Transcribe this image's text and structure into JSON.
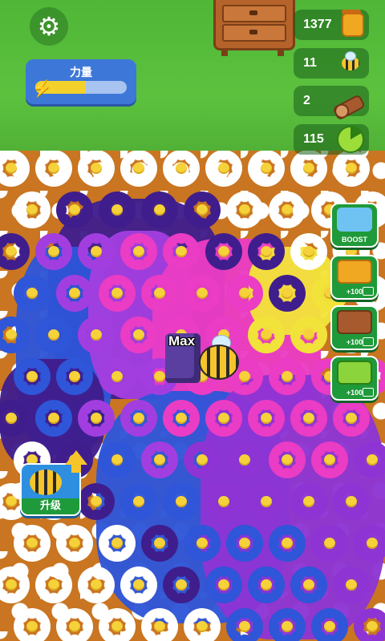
{
  "hud": {
    "settings_icon": "gear-icon",
    "power": {
      "label": "力量",
      "level_fraction": 0.55,
      "icon": "lightning-bolt-icon"
    }
  },
  "resources": {
    "honey": {
      "value": "1377",
      "icon": "honey-jar-icon"
    },
    "bees": {
      "value": "11",
      "icon": "bee-icon"
    },
    "logs": {
      "value": "2",
      "icon": "log-icon"
    },
    "pollen": {
      "value": "115",
      "icon": "pollen-pie-icon"
    }
  },
  "side_buttons": {
    "boost": {
      "label": "BOOST",
      "icon": "bee-speed-icon"
    },
    "honey_ad": {
      "label": "+100",
      "icon": "honey-jar-icon"
    },
    "log_ad": {
      "label": "+100",
      "icon": "log-icon"
    },
    "leaf_ad": {
      "label": "+100",
      "icon": "leaf-icon"
    }
  },
  "upgrade": {
    "label": "升级",
    "icon": "bee-icon"
  },
  "player": {
    "name": "Max"
  },
  "colors": {
    "grass": "#5cc23e",
    "soil": "#c97521",
    "button_green": "#1f9a3a",
    "power_blue": "#3d78d8",
    "power_fill": "#f4d12a"
  }
}
